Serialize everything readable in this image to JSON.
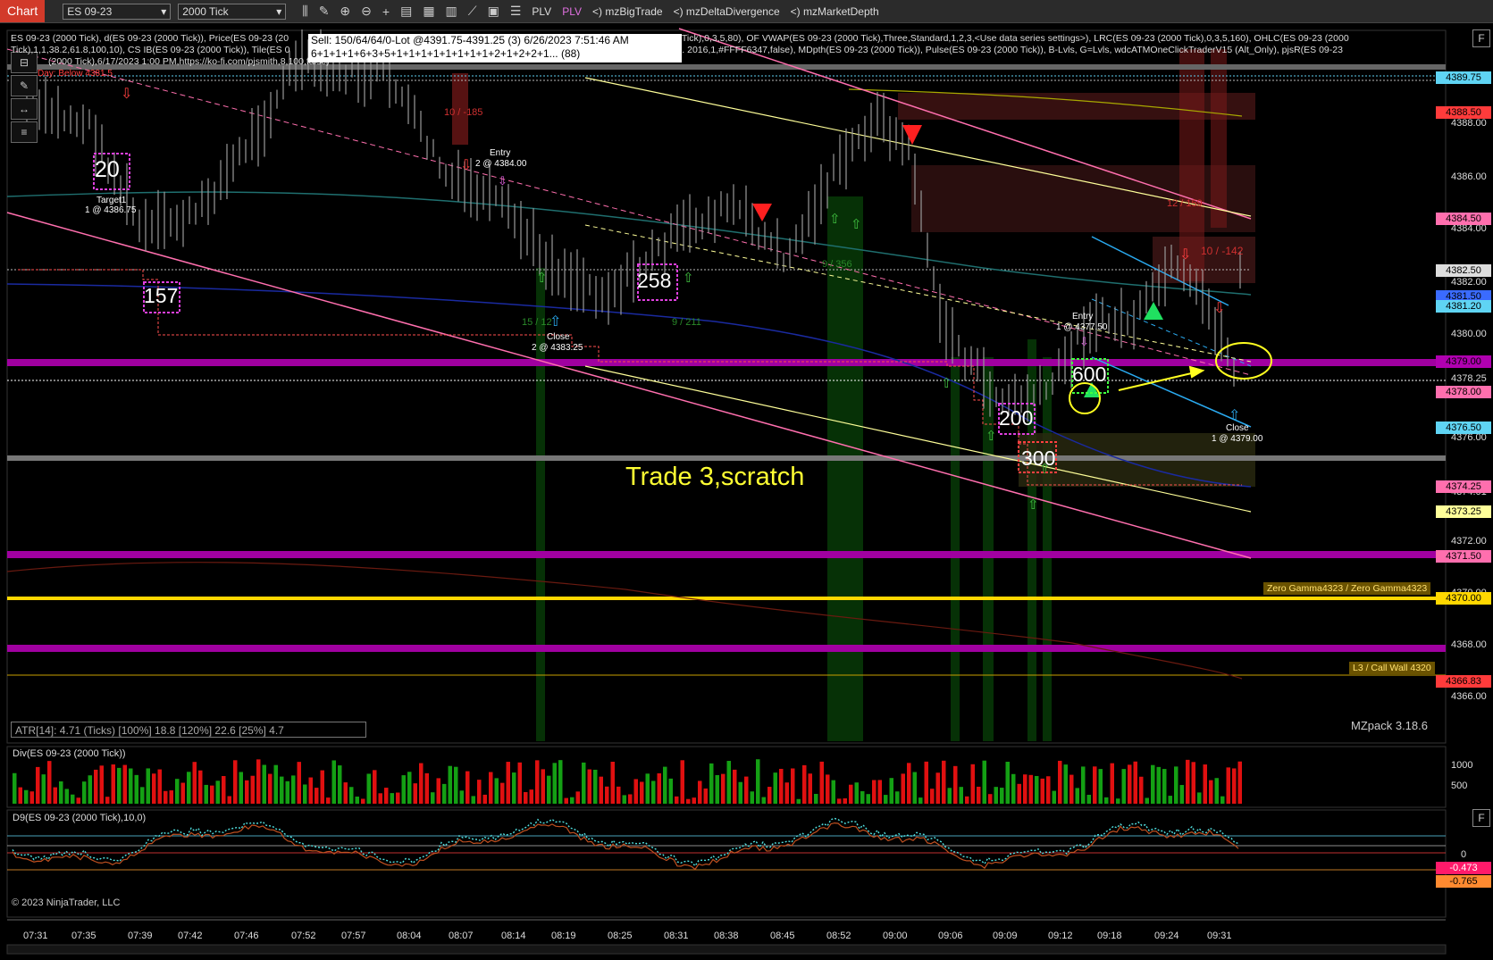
{
  "toolbar": {
    "chart_label": "Chart",
    "instrument": "ES 09-23",
    "interval": "2000 Tick",
    "plv1": "PLV",
    "plv2": "PLV",
    "indicators": [
      "<) mzBigTrade",
      "<) mzDeltaDivergence",
      "<) mzMarketDepth"
    ]
  },
  "info": {
    "line1": "ES 09-23 (2000 Tick), d(ES 09-23 (2000 Tick)), Price(ES 09-23 (20",
    "line1b": "(ES 09-23 (2000 Tick),0,3,5,80), OF VWAP(ES 09-23 (2000 Tick),Three,Standard,1,2,3,<Use data series settings>), LRC(ES 09-23 (2000 Tick),0,3,5,160), OHLC(ES 09-23 (2000",
    "line2": "Tick),1,1,38.2,61.8,100,10), CS IB(ES 09-23 (2000 Tick)), Tile(ES 0",
    "line2b": ",false,true,1,2 | Dec. 2016,1,#FFFF6347,false), MDpth(ES 09-23 (2000 Tick)), Pulse(ES 09-23 (2000 Tick)), B-Lvls, G=Lvls, wdcATMOneClickTraderV15 (Alt_Only), pjsR(ES 09-23",
    "line3": "(2000 Tick),6/17/2023 1:00 PM,https://ko-fi.com/pjsmith,8,100,false)",
    "day_below": "Day: Below 4381.5"
  },
  "sell_box": {
    "line1": "Sell:  150/64/64/0-Lot  @4391.75-4391.25  (3)  6/26/2023  7:51:46  AM",
    "line2": "6+1+1+1+6+3+5+1+1+1+1+1+1+1+1+2+1+2+2+1...  (88)"
  },
  "annotations": {
    "trade_title": "Trade 3,scratch",
    "target1_a": "Target1",
    "target1_b": "1 @ 4386.75",
    "entry1_a": "Entry",
    "entry1_b": "2 @ 4384.00",
    "close1_a": "Close",
    "close1_b": "2 @ 4383.25",
    "entry2_a": "Entry",
    "entry2_b": "1 @ 4377.50",
    "close2_a": "Close",
    "close2_b": "1 @ 4379.00",
    "ratio_a": "10 / -185",
    "ratio_b": "10 / -142",
    "ratio_c": "15 / 12",
    "ratio_d": "9 / 211",
    "ratio_e": "9 / 356",
    "ratio_f": "12 / 159",
    "big_20": "20",
    "big_157": "157",
    "big_258": "258",
    "big_200": "200",
    "big_300": "300",
    "big_600": "600",
    "zero_gamma": "Zero Gamma4323 / Zero Gamma4323",
    "call_wall": "L3 / Call Wall 4320"
  },
  "price_axis": {
    "labels": [
      "4389.75",
      "4388.00",
      "4386.00",
      "4384.00",
      "4382.00",
      "4380.00",
      "4378.25",
      "4376.00",
      "4374.01",
      "4372.00",
      "4370.00",
      "4368.00",
      "4366.00"
    ],
    "tags": [
      {
        "text": "4389.75",
        "color": "#5fd4f4"
      },
      {
        "text": "4388.50",
        "color": "#ff3b3b"
      },
      {
        "text": "4384.50",
        "color": "#ff6fae"
      },
      {
        "text": "4382.50",
        "color": "#dddddd"
      },
      {
        "text": "4381.50",
        "color": "#3a6bff"
      },
      {
        "text": "4381.20",
        "color": "#5fd4f4"
      },
      {
        "text": "4379.00",
        "color": "#b000b0"
      },
      {
        "text": "4378.00",
        "color": "#ff6fae"
      },
      {
        "text": "4376.50",
        "color": "#5fd4f4"
      },
      {
        "text": "4374.25",
        "color": "#ff6fae"
      },
      {
        "text": "4373.25",
        "color": "#ffff99"
      },
      {
        "text": "4371.50",
        "color": "#ff6fae"
      },
      {
        "text": "4370.00",
        "color": "#ffd700"
      },
      {
        "text": "4366.83",
        "color": "#ff3b3b"
      }
    ]
  },
  "atr_text": "ATR[14]: 4.71 (Ticks) [100%] 18.8  [120%] 22.6  [25%] 4.7",
  "mzpack": "MZpack 3.18.6",
  "div_panel": {
    "label": "Div(ES 09-23 (2000 Tick))",
    "axis": [
      "1000",
      "500"
    ]
  },
  "d9_panel": {
    "label": "D9(ES 09-23 (2000 Tick),10,0)",
    "axis": [
      "0.5",
      "0",
      "-0.473",
      "-0.765",
      "-0.5"
    ]
  },
  "copyright": "© 2023 NinjaTrader, LLC",
  "time_axis": [
    "07:31",
    "07:35",
    "07:39",
    "07:42",
    "07:46",
    "07:52",
    "07:57",
    "08:04",
    "08:07",
    "08:14",
    "08:19",
    "08:25",
    "08:31",
    "08:38",
    "08:45",
    "08:52",
    "09:00",
    "09:06",
    "09:09",
    "09:12",
    "09:18",
    "09:24",
    "09:31"
  ]
}
